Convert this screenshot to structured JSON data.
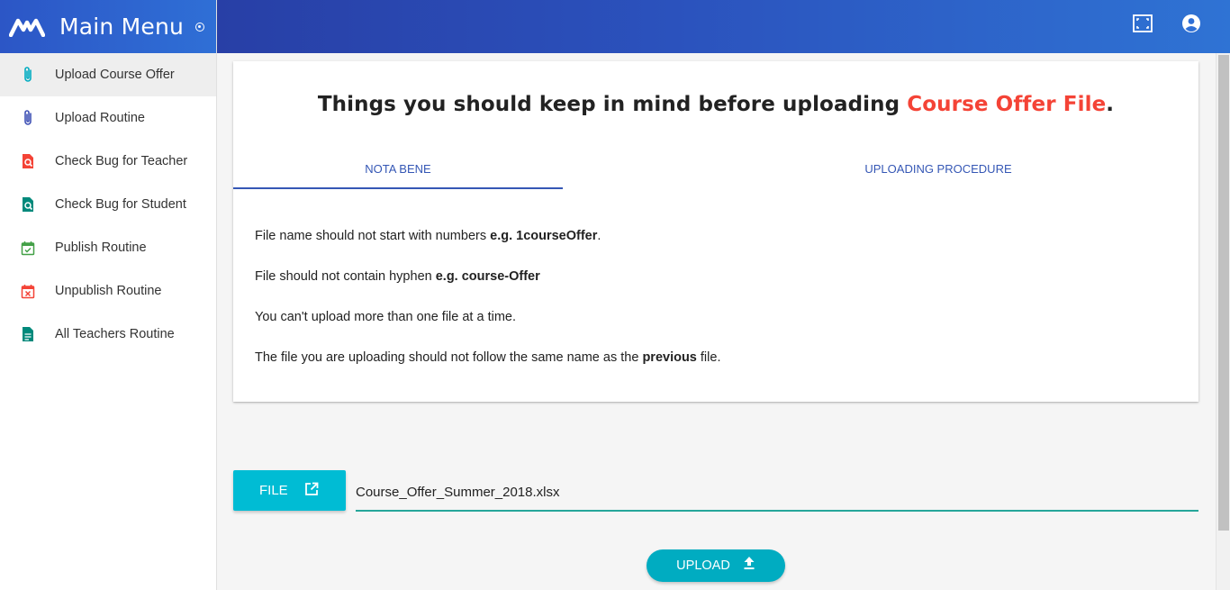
{
  "sidebar": {
    "brand_title": "Main Menu",
    "items": [
      {
        "label": "Upload Course Offer",
        "icon": "paperclip-icon",
        "color": "#00acc1",
        "active": true
      },
      {
        "label": "Upload Routine",
        "icon": "paperclip-icon",
        "color": "#3f51b5"
      },
      {
        "label": "Check Bug for Teacher",
        "icon": "file-search-icon",
        "color": "#f44336"
      },
      {
        "label": "Check Bug for Student",
        "icon": "file-search-icon",
        "color": "#00897b"
      },
      {
        "label": "Publish Routine",
        "icon": "calendar-check-icon",
        "color": "#43a047"
      },
      {
        "label": "Unpublish Routine",
        "icon": "calendar-remove-icon",
        "color": "#f44336"
      },
      {
        "label": "All Teachers Routine",
        "icon": "document-icon",
        "color": "#00897b"
      }
    ]
  },
  "header": {
    "fullscreen_icon": "fullscreen-icon",
    "account_icon": "account-circle-icon"
  },
  "card": {
    "title_prefix": "Things you should keep in mind before uploading ",
    "title_accent": "Course Offer File",
    "title_suffix": ".",
    "accent_color": "#f44336",
    "tabs": [
      "NOTA BENE",
      "UPLOADING PROCEDURE"
    ],
    "active_tab": "NOTA BENE",
    "notes": [
      {
        "before": "File name should not start with numbers ",
        "bold": "e.g. 1courseOffer",
        "after": "."
      },
      {
        "before": "File should not contain hyphen ",
        "bold": "e.g. course-Offer",
        "after": ""
      },
      {
        "before": "You can't upload more than one file at a time.",
        "bold": "",
        "after": ""
      },
      {
        "before": "The file you are uploading should not follow the same name as the ",
        "bold": "previous",
        "after": " file."
      }
    ]
  },
  "upload": {
    "file_button_label": "FILE",
    "file_button_icon": "open-in-new-icon",
    "file_name": "Course_Offer_Summer_2018.xlsx",
    "upload_button_label": "UPLOAD",
    "upload_button_icon": "upload-icon",
    "primary_color": "#00bcd4"
  }
}
